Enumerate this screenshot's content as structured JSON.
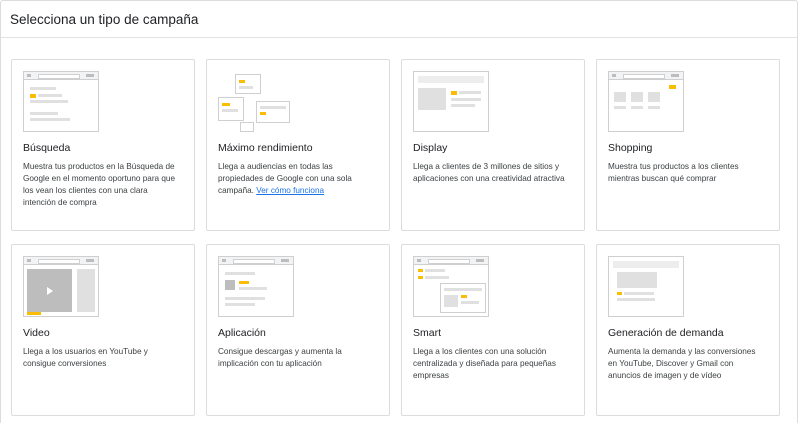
{
  "header": {
    "title": "Selecciona un tipo de campaña"
  },
  "cards": [
    {
      "icon": "search-results-illustration",
      "title": "Búsqueda",
      "description": "Muestra tus productos en la Búsqueda de Google en el momento oportuno para que los vean los clientes con una clara intención de compra"
    },
    {
      "icon": "multi-channel-illustration",
      "title": "Máximo rendimiento",
      "description": "Llega a audiencias en todas las propiedades de Google con una sola campaña.",
      "link": "Ver cómo funciona"
    },
    {
      "icon": "display-ad-illustration",
      "title": "Display",
      "description": "Llega a clientes de 3 millones de sitios y aplicaciones con una creatividad atractiva"
    },
    {
      "icon": "shopping-listing-illustration",
      "title": "Shopping",
      "description": "Muestra tus productos a los clientes mientras buscan qué comprar"
    },
    {
      "icon": "video-player-illustration",
      "title": "Video",
      "description": "Llega a los usuarios en YouTube y consigue conversiones"
    },
    {
      "icon": "app-install-illustration",
      "title": "Aplicación",
      "description": "Consigue descargas y aumenta la implicación con tu aplicación"
    },
    {
      "icon": "smart-campaign-illustration",
      "title": "Smart",
      "description": "Llega a los clientes con una solución centralizada y diseñada para pequeñas empresas"
    },
    {
      "icon": "demand-gen-illustration",
      "title": "Generación de demanda",
      "description": "Aumenta la demanda y las conversiones en YouTube, Discover y Gmail con anuncios de imagen y de vídeo"
    }
  ],
  "colors": {
    "accent_yellow": "#fbbc04",
    "link_blue": "#1a73e8",
    "border": "#dadce0"
  }
}
